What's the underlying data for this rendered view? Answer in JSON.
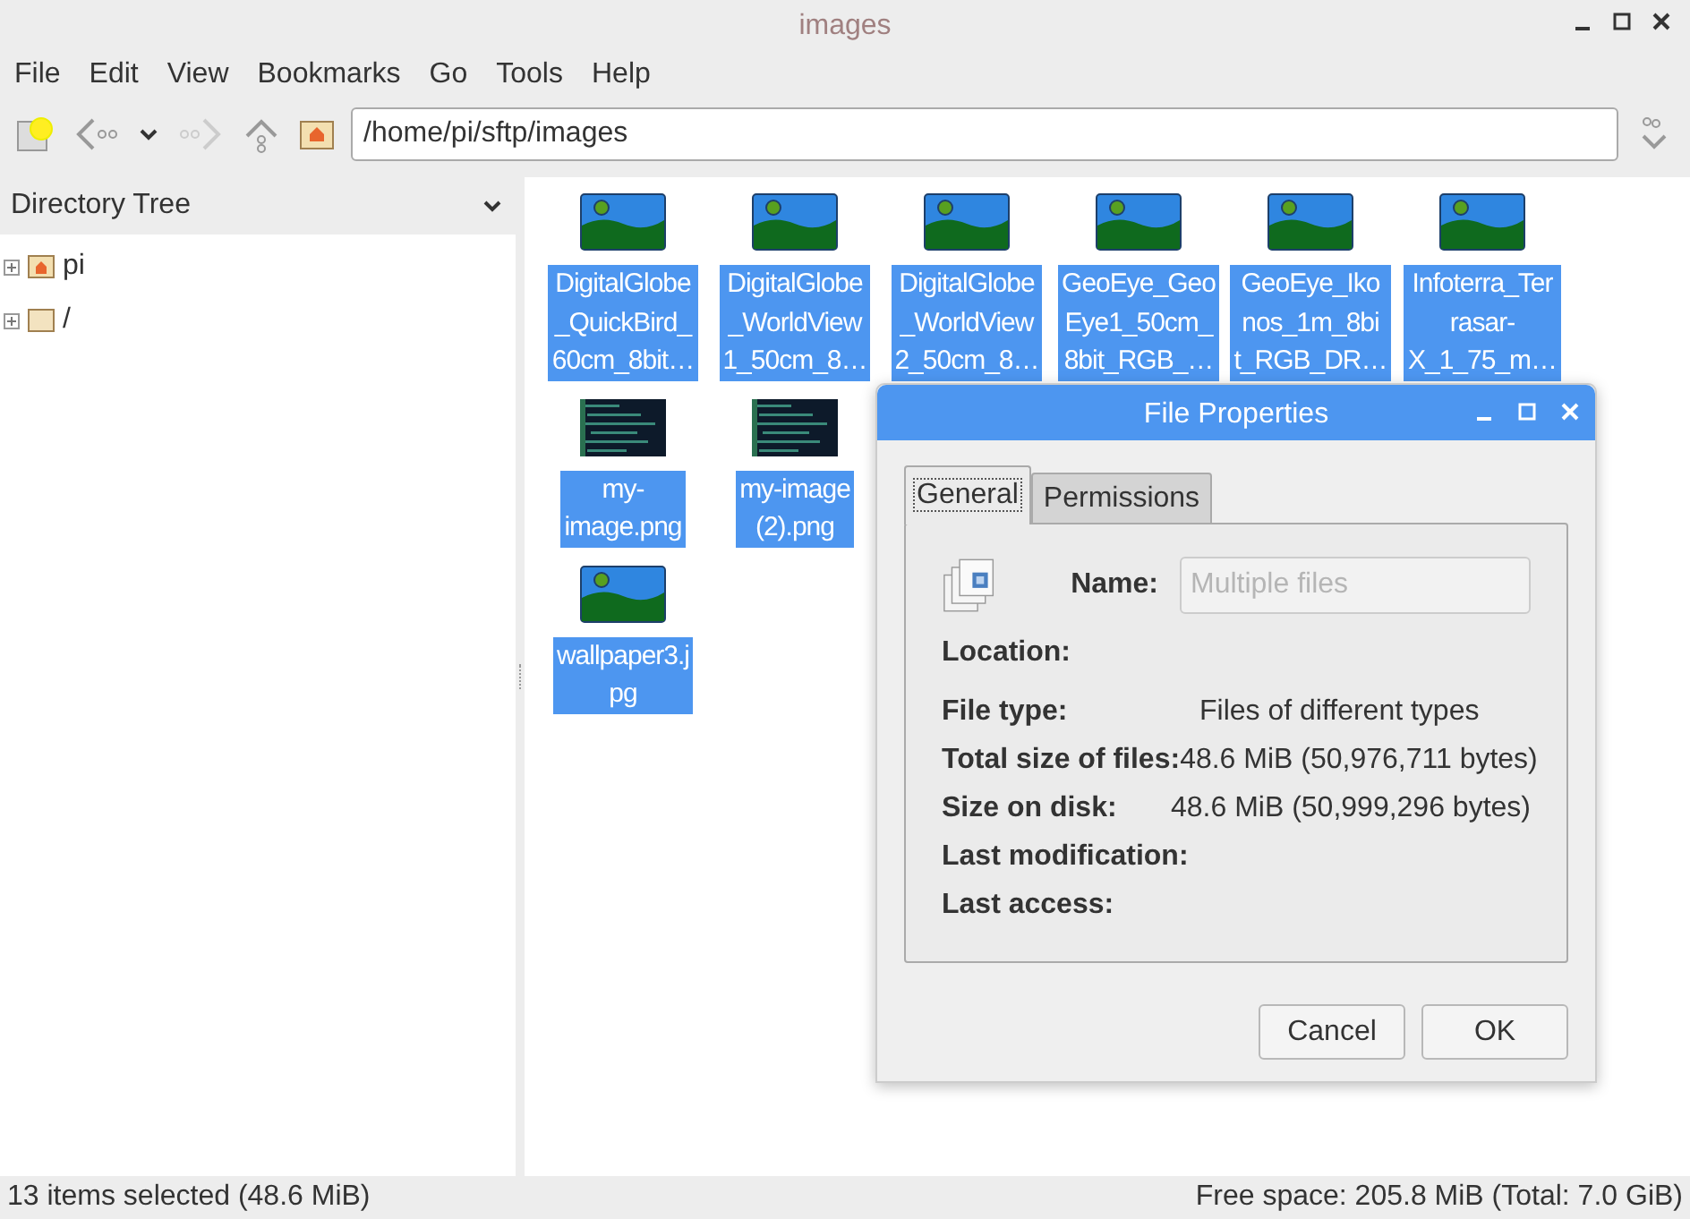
{
  "window": {
    "title": "images"
  },
  "menu": [
    "File",
    "Edit",
    "View",
    "Bookmarks",
    "Go",
    "Tools",
    "Help"
  ],
  "toolbar": {
    "path": "/home/pi/sftp/images"
  },
  "sidebar": {
    "title": "Directory Tree",
    "items": [
      {
        "label": "pi",
        "kind": "home",
        "expanded": false
      },
      {
        "label": "/",
        "kind": "folder",
        "expanded": false
      }
    ]
  },
  "file_rows": [
    [
      {
        "lines": [
          "DigitalGlobe",
          "_QuickBird_",
          "60cm_8bit…"
        ],
        "kind": "image",
        "selected": true
      },
      {
        "lines": [
          "DigitalGlobe",
          "_WorldView",
          "1_50cm_8…"
        ],
        "kind": "image",
        "selected": true
      },
      {
        "lines": [
          "DigitalGlobe",
          "_WorldView",
          "2_50cm_8…"
        ],
        "kind": "image",
        "selected": true
      },
      {
        "lines": [
          "GeoEye_Geo",
          "Eye1_50cm_",
          "8bit_RGB_…"
        ],
        "kind": "image",
        "selected": true
      },
      {
        "lines": [
          "GeoEye_Iko",
          "nos_1m_8bi",
          "t_RGB_DR…"
        ],
        "kind": "image",
        "selected": true
      },
      {
        "lines": [
          "Infoterra_Ter",
          "rasar-",
          "X_1_75_m…"
        ],
        "kind": "image",
        "selected": true
      }
    ],
    [
      {
        "lines": [
          "my-",
          "image.png"
        ],
        "kind": "screenshot",
        "selected": true
      },
      {
        "lines": [
          "my-image",
          "(2).png"
        ],
        "kind": "screenshot",
        "selected": true
      }
    ],
    [
      {
        "lines": [
          "wallpaper3.j",
          "pg"
        ],
        "kind": "image",
        "selected": true
      }
    ]
  ],
  "dialog": {
    "title": "File Properties",
    "tabs": [
      {
        "label": "General",
        "selected": true
      },
      {
        "label": "Permissions",
        "selected": false
      }
    ],
    "name_label": "Name:",
    "name_placeholder": "Multiple files",
    "fields": [
      {
        "label": "Location:"
      },
      {
        "label": "File type:",
        "value": "Files of different types"
      },
      {
        "label": "Total size of files:",
        "value": "48.6 MiB (50,976,711 bytes)"
      },
      {
        "label": "Size on disk:",
        "value": "48.6 MiB (50,999,296 bytes)"
      },
      {
        "label": "Last modification:"
      },
      {
        "label": "Last access:"
      }
    ],
    "buttons": [
      "Cancel",
      "OK"
    ]
  },
  "status_bar": {
    "left": "13 items selected (48.6 MiB)",
    "right": "Free space: 205.8 MiB (Total: 7.0 GiB)"
  }
}
